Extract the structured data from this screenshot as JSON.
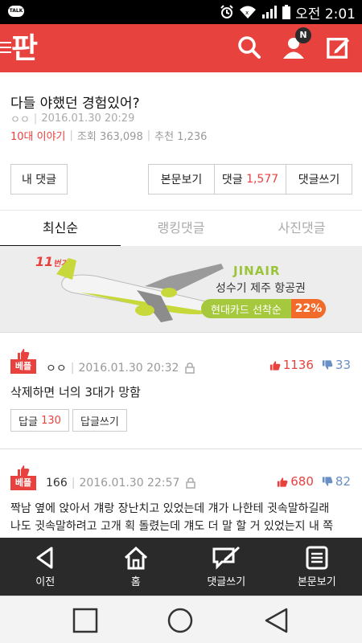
{
  "status_bar": {
    "app_icon": "TALK",
    "time": "오전 2:01"
  },
  "header": {
    "logo": "판",
    "notification_badge": "N",
    "accent": "#e8423f"
  },
  "post": {
    "title": "다들 야했던 경험있어?",
    "author": "ㅇㅇ",
    "date": "2016.01.30 20:29",
    "category": "10대 이야기",
    "views_label": "조회 363,098",
    "recommend_label": "추천 1,236"
  },
  "buttons": {
    "my_comments": "내 댓글",
    "view_post": "본문보기",
    "comments_label": "댓글",
    "comments_count": "1,577",
    "write_comment": "댓글쓰기"
  },
  "tabs": [
    {
      "label": "최신순",
      "active": true
    },
    {
      "label": "랭킹댓글",
      "active": false
    },
    {
      "label": "사진댓글",
      "active": false
    }
  ],
  "ad": {
    "number_main": "11",
    "number_sub": "번가",
    "brand": "JINAIR",
    "line1": "성수기 제주 항공권",
    "pill_text": "현대카드 선착순",
    "pill_pct": "22%"
  },
  "comments": [
    {
      "badge": "베플",
      "author": "ㅇㅇ",
      "date": "2016.01.30 20:32",
      "up": "1136",
      "down": "33",
      "text": "삭제하면 너의 3대가 망함",
      "reply_label": "답글",
      "reply_count": "130",
      "write_reply": "답글쓰기"
    },
    {
      "badge": "베플",
      "author": "166",
      "date": "2016.01.30 22:57",
      "up": "680",
      "down": "82",
      "text_line1": "짝남 옆에 앉아서 걔랑 장난치고 있었는데 걔가 나한테 귓속말하길래",
      "text_line2": "나도 귓속말하려고 고개 획 돌렸는데 걔도 더 말 할 거 있었는지 내 쪽"
    }
  ],
  "toolbar": [
    {
      "label": "이전",
      "icon": "back-arrow-icon"
    },
    {
      "label": "홈",
      "icon": "home-icon"
    },
    {
      "label": "댓글쓰기",
      "icon": "comment-write-icon"
    },
    {
      "label": "본문보기",
      "icon": "document-icon"
    }
  ]
}
